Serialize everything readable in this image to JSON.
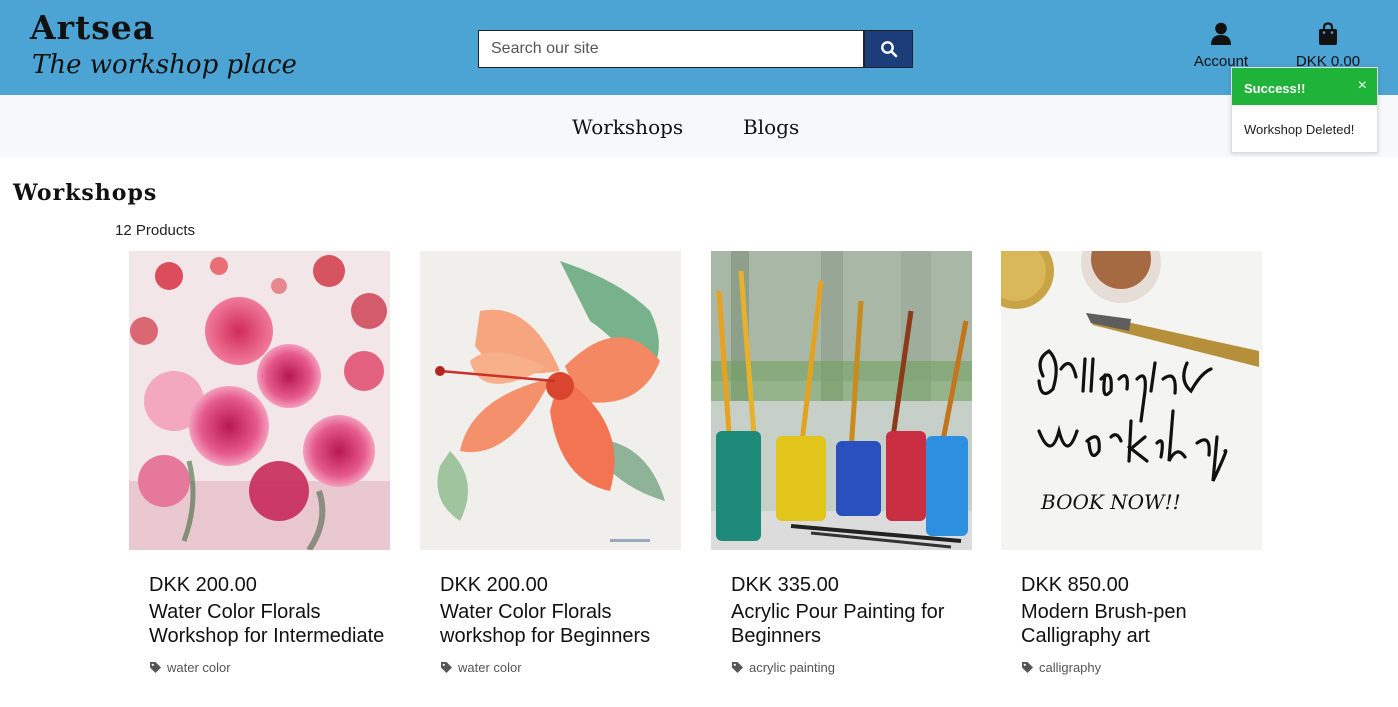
{
  "brand": {
    "title": "Artsea",
    "tagline": "The workshop place"
  },
  "search": {
    "placeholder": "Search our site"
  },
  "header": {
    "account_label": "Account",
    "cart_label": "DKK 0.00"
  },
  "nav": {
    "items": [
      {
        "label": "Workshops"
      },
      {
        "label": "Blogs"
      }
    ]
  },
  "toast": {
    "title": "Success!!",
    "close": "×",
    "message": "Workshop Deleted!"
  },
  "main": {
    "title": "Workshops",
    "count": "12 Products"
  },
  "products": [
    {
      "price": "DKK 200.00",
      "name": "Water Color Florals Workshop for Intermediate",
      "tag": "water color"
    },
    {
      "price": "DKK 200.00",
      "name": "Water Color Florals workshop for Beginners",
      "tag": "water color"
    },
    {
      "price": "DKK 335.00",
      "name": "Acrylic Pour Painting for Beginners",
      "tag": "acrylic painting"
    },
    {
      "price": "DKK 850.00",
      "name": "Modern Brush-pen Calligraphy art",
      "tag": "calligraphy"
    }
  ],
  "colors": {
    "header_bg": "#4ba4d3",
    "search_btn": "#1b3d7a",
    "toast_success": "#1fb33a",
    "nav_bg": "#f7f8f9"
  }
}
